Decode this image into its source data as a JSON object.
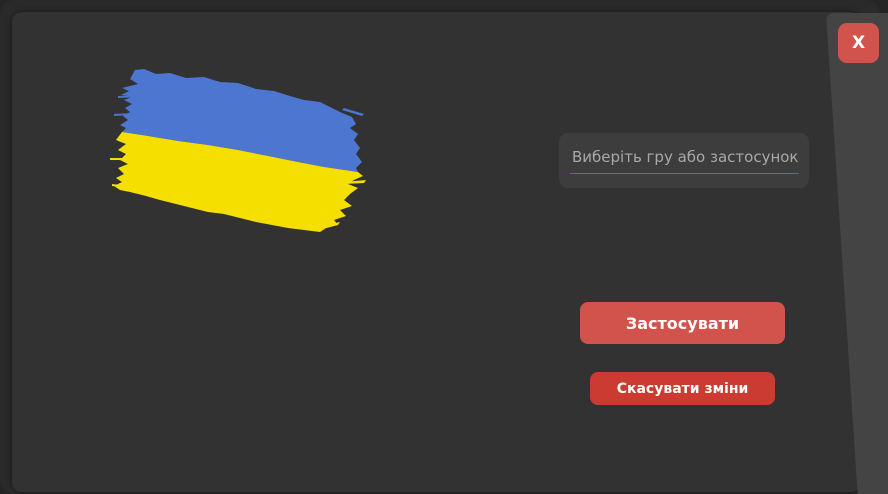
{
  "window": {
    "close_label": "X"
  },
  "flag": {
    "icon": "ukraine-flag-icon",
    "colors": {
      "top": "#4d76d1",
      "bottom": "#f5df00"
    }
  },
  "selector": {
    "placeholder": "Виберіть гру або застосунок"
  },
  "actions": {
    "apply_label": "Застосувати",
    "cancel_label": "Скасувати зміни"
  },
  "colors": {
    "accent": "#d1534b",
    "panel": "#323232",
    "field": "#3d3d3d"
  }
}
